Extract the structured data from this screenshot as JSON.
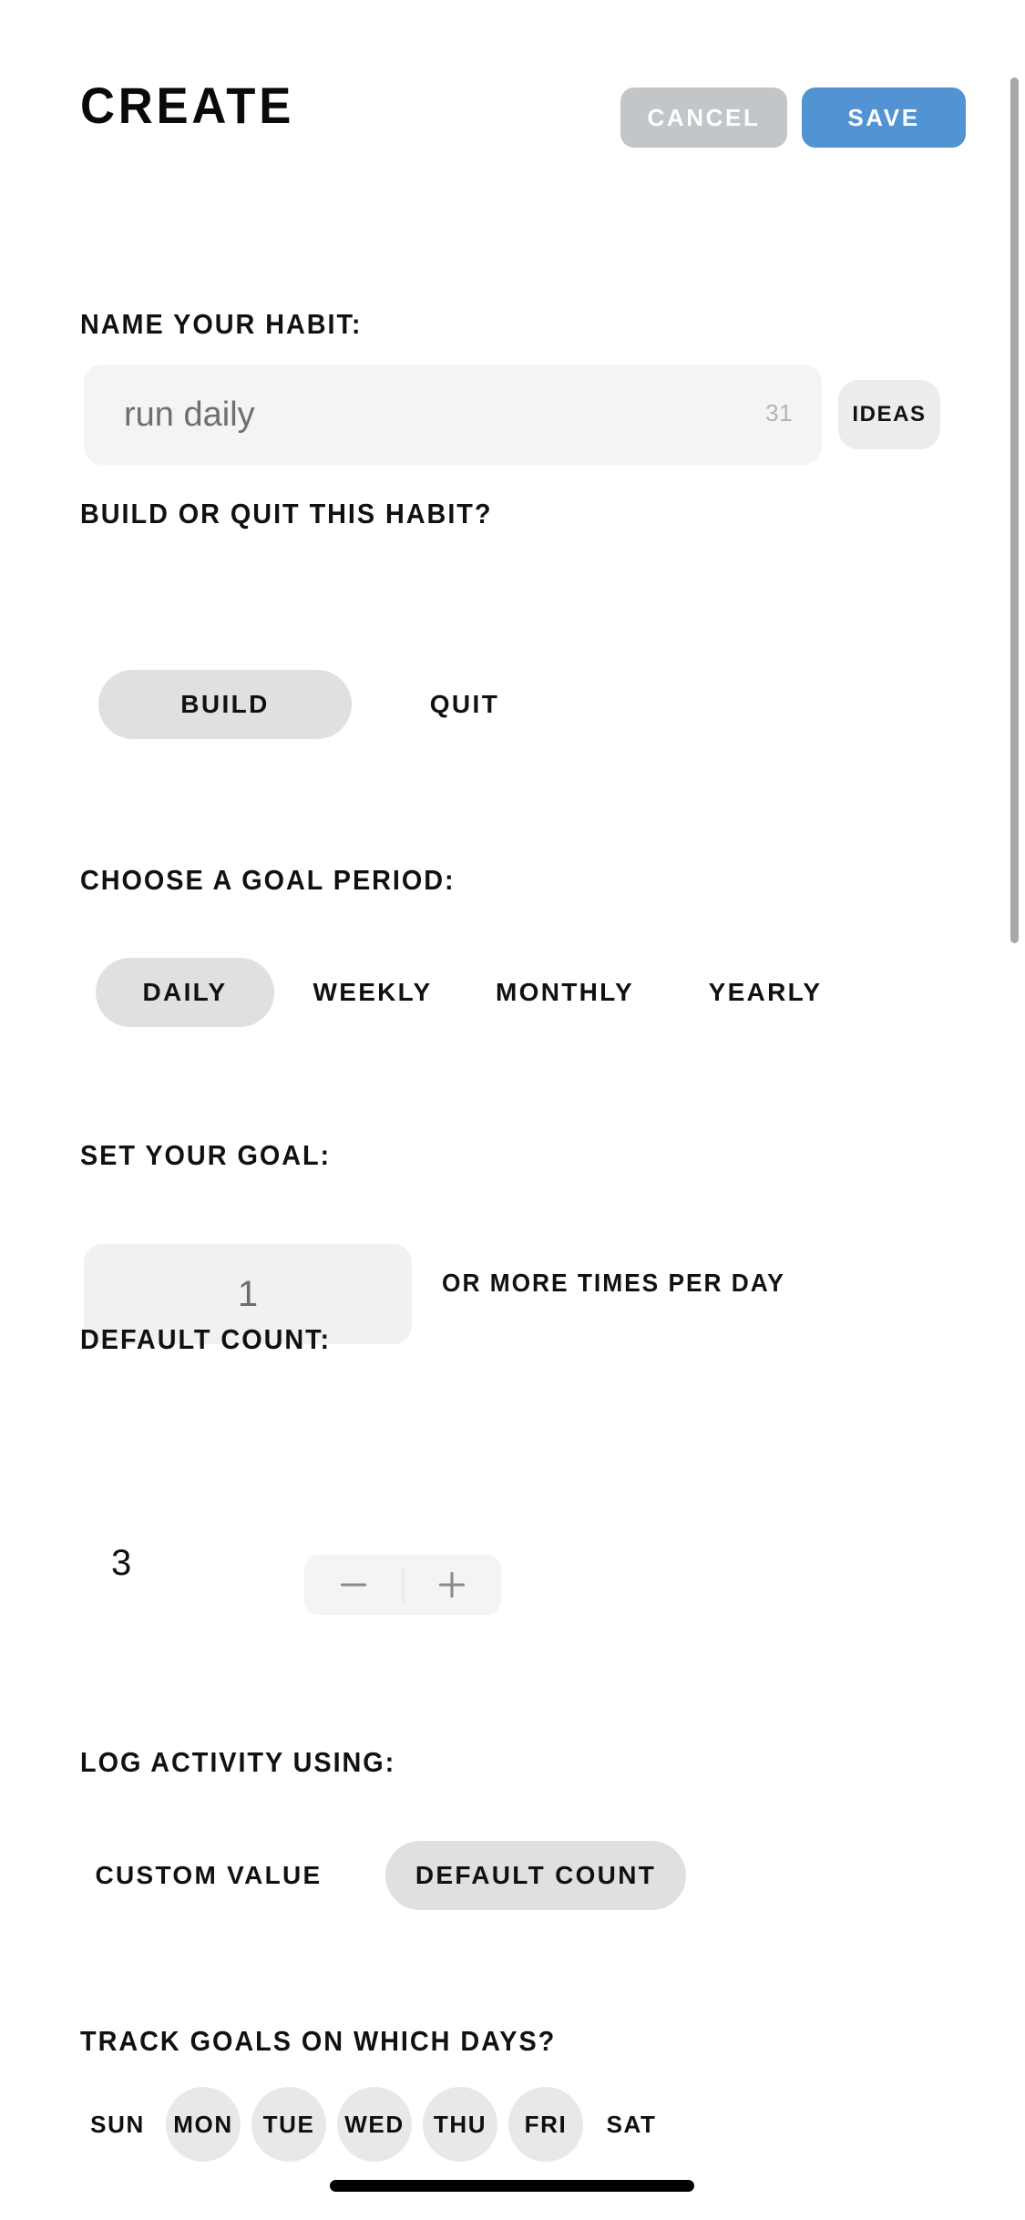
{
  "header": {
    "title": "CREATE",
    "cancel_label": "CANCEL",
    "save_label": "SAVE",
    "cancel_color": "#c2c6c8",
    "save_color": "#5293d4"
  },
  "name_section": {
    "label": "NAME YOUR HABIT:",
    "value": "run daily",
    "placeholder": "run daily",
    "char_counter": "31",
    "ideas_label": "IDEAS"
  },
  "build_quit_section": {
    "label": "BUILD OR QUIT THIS HABIT?",
    "options": [
      {
        "label": "BUILD",
        "selected": true
      },
      {
        "label": "QUIT",
        "selected": false
      }
    ]
  },
  "goal_period_section": {
    "label": "CHOOSE A GOAL PERIOD:",
    "options": [
      {
        "label": "DAILY",
        "selected": true
      },
      {
        "label": "WEEKLY",
        "selected": false
      },
      {
        "label": "MONTHLY",
        "selected": false
      },
      {
        "label": "YEARLY",
        "selected": false
      }
    ]
  },
  "goal_section": {
    "label": "SET YOUR GOAL:",
    "value": "1",
    "placeholder": "1",
    "unit_label": "OR MORE TIMES PER DAY"
  },
  "default_count_section": {
    "label": "DEFAULT COUNT:",
    "value": "3",
    "decrement_icon": "minus-icon",
    "increment_icon": "plus-icon"
  },
  "log_activity_section": {
    "label": "LOG ACTIVITY USING:",
    "options": [
      {
        "label": "CUSTOM VALUE",
        "selected": false
      },
      {
        "label": "DEFAULT COUNT",
        "selected": true
      }
    ]
  },
  "days_section": {
    "label": "TRACK GOALS ON WHICH DAYS?",
    "days": [
      {
        "label": "SUN",
        "selected": false
      },
      {
        "label": "MON",
        "selected": true
      },
      {
        "label": "TUE",
        "selected": true
      },
      {
        "label": "WED",
        "selected": true
      },
      {
        "label": "THU",
        "selected": true
      },
      {
        "label": "FRI",
        "selected": true
      },
      {
        "label": "SAT",
        "selected": false
      }
    ]
  },
  "colors": {
    "selected_pill": "#e0e0e0",
    "input_background": "#f4f4f4",
    "accent": "#5293d4"
  }
}
